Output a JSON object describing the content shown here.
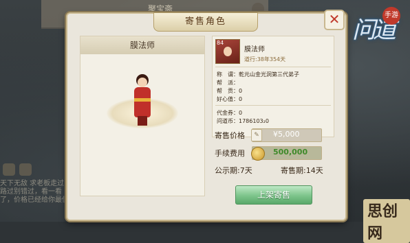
{
  "background": {
    "panel_title": "聚宝斋",
    "left_text": "天下无敌 求老板走过路过别错过，看一看了，价格已经给你最低",
    "logo_text": "问道",
    "logo_badge": "手游"
  },
  "dialog": {
    "title": "寄售角色",
    "close_symbol": "✕"
  },
  "character": {
    "name": "膜法师"
  },
  "info": {
    "level": "84",
    "name": "膜法师",
    "online_time": "道行:38年354天",
    "rows": [
      {
        "label": "称　谓：",
        "value": "乾元山金光洞第三代弟子"
      },
      {
        "label": "帮　派：",
        "value": ""
      },
      {
        "label": "帮　贡：",
        "value": "0"
      },
      {
        "label": "好心值：",
        "value": "0"
      },
      {
        "label": "代金券：",
        "value": "0"
      },
      {
        "label": "问道币：",
        "value": "1786103₂0"
      }
    ]
  },
  "sale": {
    "price_label": "寄售价格",
    "price_value": "¥5,000",
    "fee_label": "手续费用",
    "fee_value": "500,000",
    "public_period": "公示期:7天",
    "sale_period": "寄售期:14天",
    "submit_label": "上架寄售"
  },
  "watermark": "思创网",
  "colors": {
    "accent_green": "#5aa86a",
    "fee_green": "#3f8a2a",
    "close_red": "#c0392b",
    "dialog_bg": "#eae6dc"
  }
}
